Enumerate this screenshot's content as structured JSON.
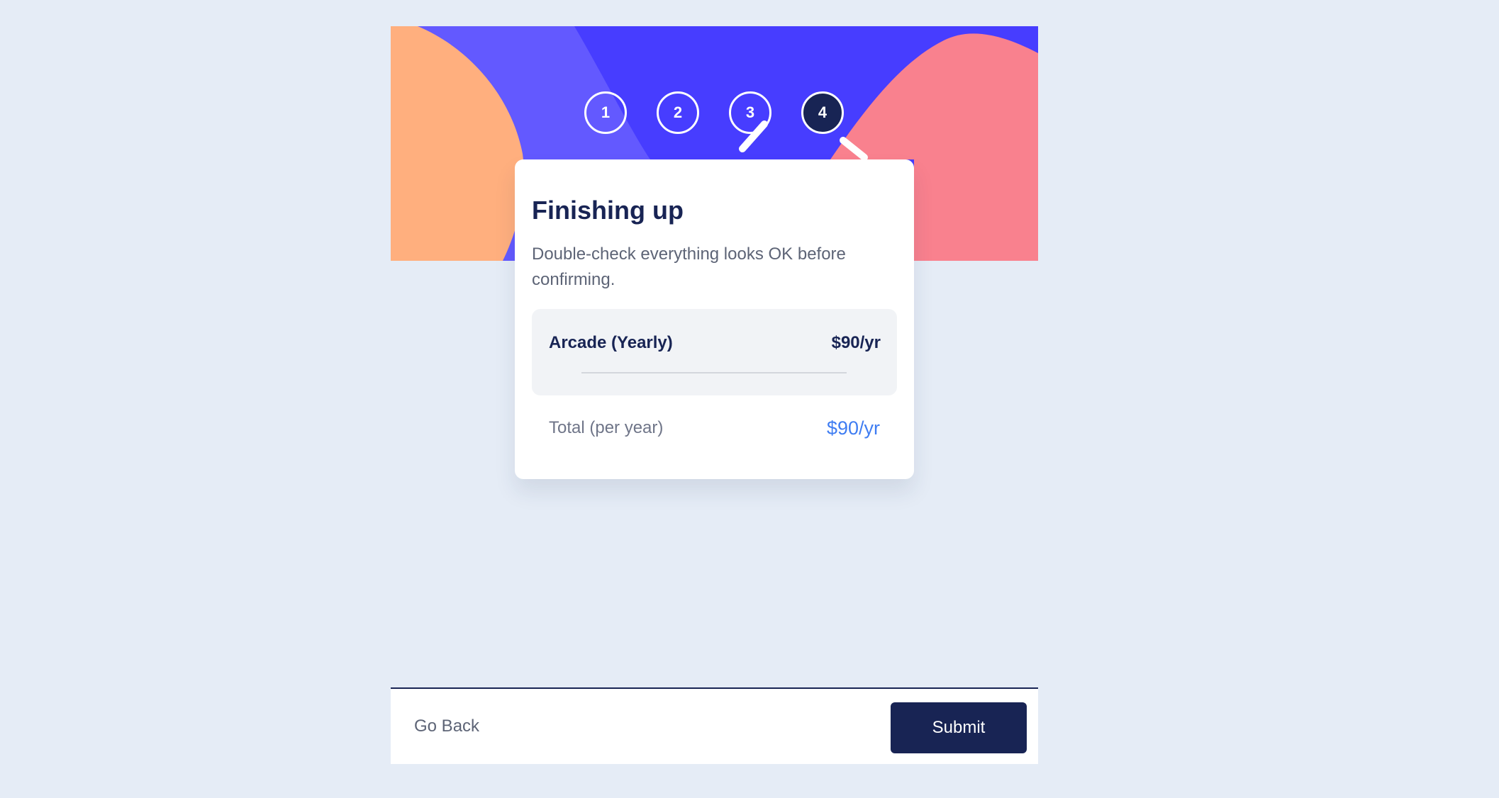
{
  "colors": {
    "page_background": "#e5ecf6",
    "banner_blue": "#473dff",
    "banner_light_blue": "#6359ff",
    "banner_orange": "#ffaf7e",
    "banner_pink": "#f9818e",
    "primary_dark": "#182454",
    "accent_blue": "#3f7df2",
    "summary_background": "#f1f3f6"
  },
  "stepper": {
    "steps": [
      {
        "label": "1"
      },
      {
        "label": "2"
      },
      {
        "label": "3"
      },
      {
        "label": "4"
      }
    ],
    "active_step": 4
  },
  "finishing": {
    "title": "Finishing up",
    "subtitle": "Double-check everything looks OK before confirming.",
    "plan": {
      "name": "Arcade (Yearly)",
      "price": "$90/yr"
    },
    "total": {
      "label": "Total (per year)",
      "price": "$90/yr"
    }
  },
  "footer": {
    "back_label": "Go Back",
    "submit_label": "Submit"
  }
}
